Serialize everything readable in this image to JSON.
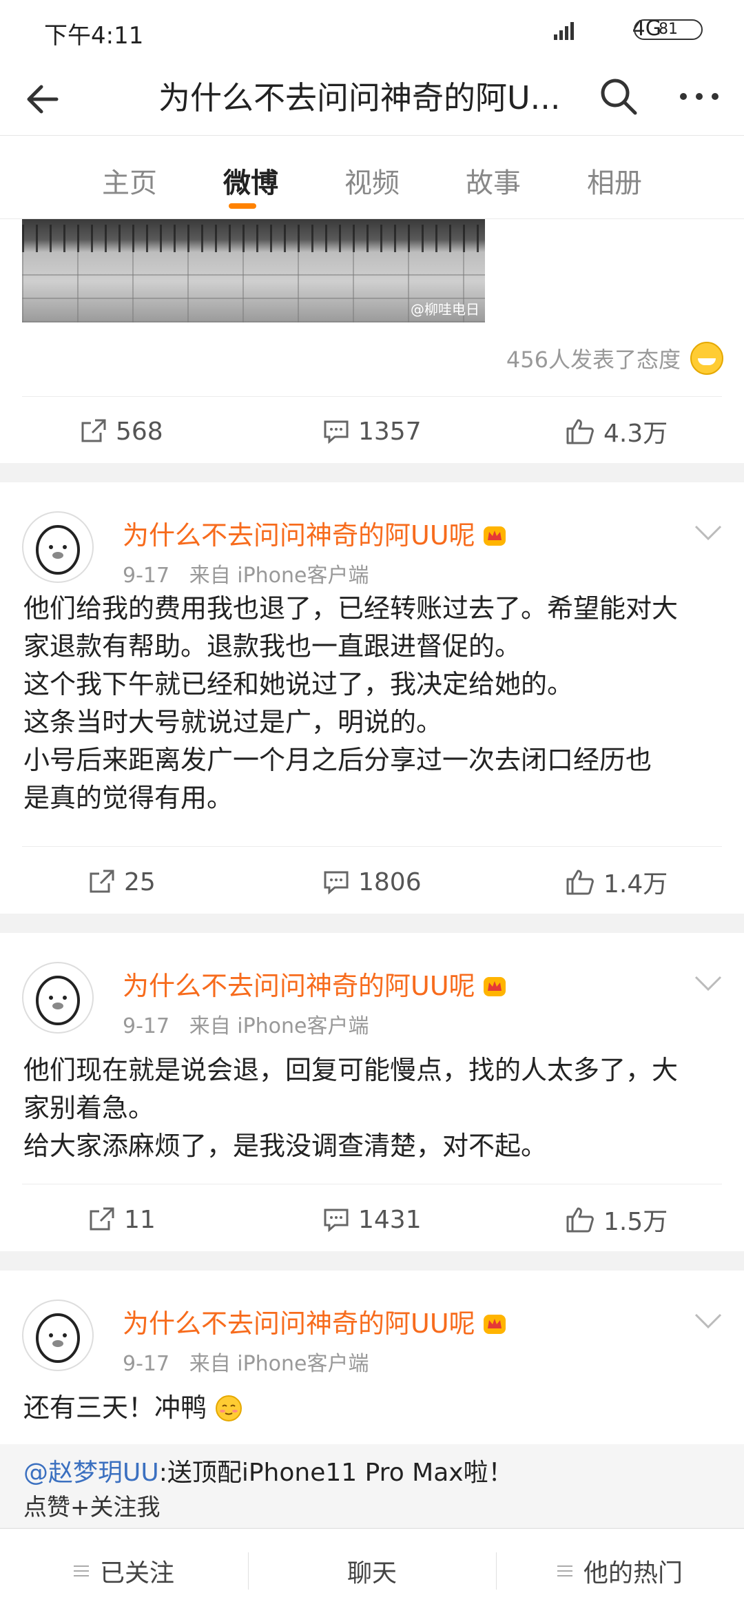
{
  "status": {
    "time": "下午4:11",
    "network": "4G",
    "battery": "81"
  },
  "nav": {
    "title": "为什么不去问问神奇的阿U..."
  },
  "tabs": [
    {
      "label": "主页"
    },
    {
      "label": "微博"
    },
    {
      "label": "视频"
    },
    {
      "label": "故事"
    },
    {
      "label": "相册"
    }
  ],
  "top_post": {
    "image_watermark": "@柳哇电日",
    "reactions_text": "456人发表了态度",
    "repost": "568",
    "comment": "1357",
    "like": "4.3万"
  },
  "posts": [
    {
      "user": "为什么不去问问神奇的阿UU呢",
      "date": "9-17",
      "source": "来自 iPhone客户端",
      "lines": [
        "他们给我的费用我也退了，已经转账过去了。希望能对大",
        "家退款有帮助。退款我也一直跟进督促的。",
        "这个我下午就已经和她说过了，我决定给她的。",
        "这条当时大号就说过是广，明说的。",
        "小号后来距离发广一个月之后分享过一次去闭口经历也",
        "是真的觉得有用。"
      ],
      "repost": "25",
      "comment": "1806",
      "like": "1.4万"
    },
    {
      "user": "为什么不去问问神奇的阿UU呢",
      "date": "9-17",
      "source": "来自 iPhone客户端",
      "lines": [
        "他们现在就是说会退，回复可能慢点，找的人太多了，大",
        "家别着急。",
        "给大家添麻烦了，是我没调查清楚，对不起。"
      ],
      "repost": "11",
      "comment": "1431",
      "like": "1.5万"
    },
    {
      "user": "为什么不去问问神奇的阿UU呢",
      "date": "9-17",
      "source": "来自 iPhone客户端",
      "lines": [
        "还有三天！冲鸭"
      ]
    }
  ],
  "ad": {
    "mention": "@赵梦玥UU",
    "text": ":送顶配iPhone11 Pro Max啦！",
    "line2": "点赞+关注我"
  },
  "bottom_bar": {
    "follow": "已关注",
    "chat": "聊天",
    "hot": "他的热门"
  }
}
